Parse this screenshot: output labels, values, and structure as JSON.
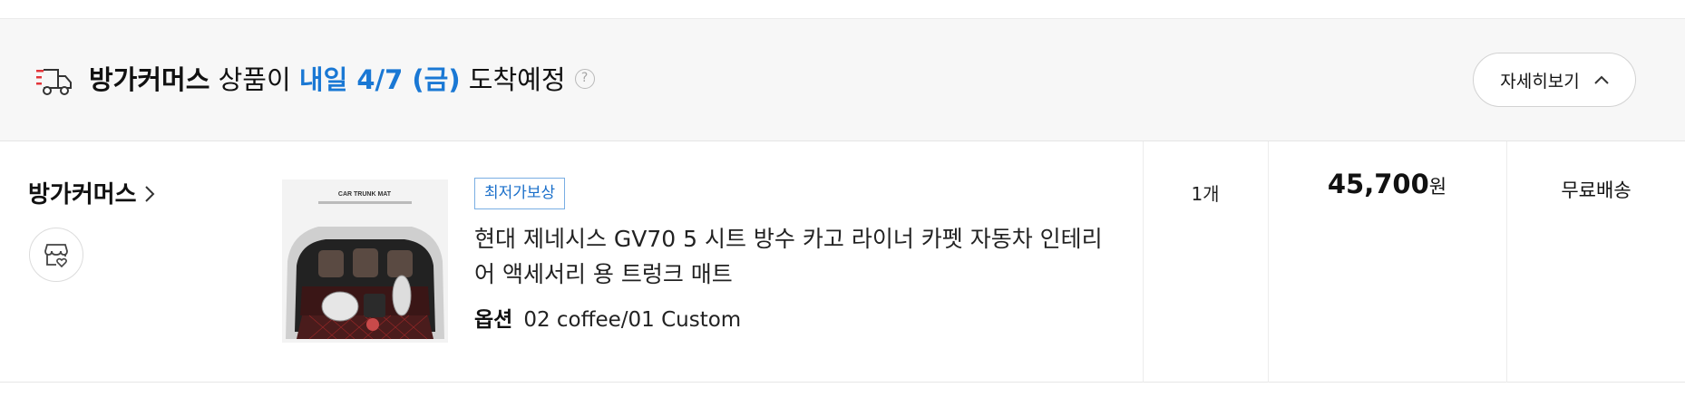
{
  "delivery": {
    "seller": "방가커머스",
    "middle": " 상품이 ",
    "date": "내일 4/7 (금)",
    "suffix": " 도착예정",
    "help": "?",
    "detail_button": "자세히보기",
    "icons": {
      "truck": "delivery-truck-icon",
      "help": "question-circle-icon",
      "toggle": "chevron-up-icon"
    }
  },
  "order": {
    "seller_name": "방가커머스",
    "badge": "최저가보상",
    "title": "현대 제네시스 GV70 5 시트 방수 카고 라이너 카펫 자동차 인테리어 액세서리 용 트렁크 매트",
    "option_label": "옵션",
    "option_value": "02 coffee/01 Custom",
    "quantity": "1개",
    "price_amount": "45,700",
    "price_unit": "원",
    "shipping": "무료배송",
    "thumbnail_text": "CAR TRUNK MAT",
    "icons": {
      "seller_link": "chevron-right-icon",
      "store": "store-heart-icon"
    }
  },
  "colors": {
    "accent_blue": "#1a78d4",
    "badge_border": "#79aee3",
    "bar_bg": "#f7f7f7",
    "truck_red": "#e3353a"
  }
}
